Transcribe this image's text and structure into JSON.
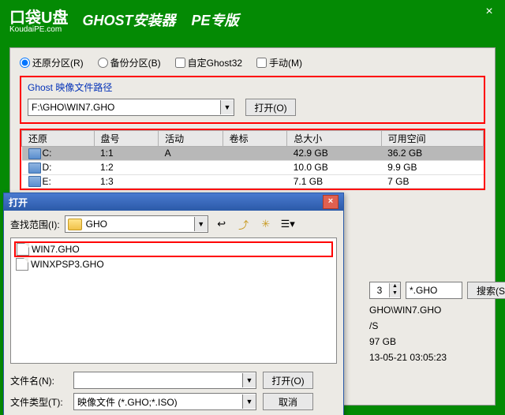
{
  "header": {
    "logo_main": "口袋U盘",
    "logo_sub": "KoudaiPE.com",
    "title_installer": "GHOST安装器",
    "title_edition": "PE专版",
    "close": "×"
  },
  "radios": {
    "restore": "还原分区(R)",
    "backup": "备份分区(B)",
    "custom": "自定Ghost32",
    "manual": "手动(M)"
  },
  "ghost_group": {
    "title": "Ghost 映像文件路径",
    "path": "F:\\GHO\\WIN7.GHO",
    "open_btn": "打开(O)"
  },
  "grid": {
    "headers": [
      "还原",
      "盘号",
      "活动",
      "卷标",
      "总大小",
      "可用空间"
    ],
    "rows": [
      {
        "drive": "C:",
        "num": "1:1",
        "active": "A",
        "label": "",
        "total": "42.9 GB",
        "free": "36.2 GB",
        "sel": true
      },
      {
        "drive": "D:",
        "num": "1:2",
        "active": "",
        "label": "",
        "total": "10.0 GB",
        "free": "9.9 GB",
        "sel": false
      },
      {
        "drive": "E:",
        "num": "1:3",
        "active": "",
        "label": "",
        "total": "7.1 GB",
        "free": "7 GB",
        "sel": false
      }
    ]
  },
  "opendlg": {
    "title": "打开",
    "lookin_label": "查找范围(I):",
    "folder": "GHO",
    "files": [
      {
        "name": "WIN7.GHO",
        "sel": true
      },
      {
        "name": "WINXPSP3.GHO",
        "sel": false
      }
    ],
    "filename_label": "文件名(N):",
    "filename_value": "",
    "filetype_label": "文件类型(T):",
    "filetype_value": "映像文件 (*.GHO;*.ISO)",
    "open_btn": "打开(O)",
    "cancel_btn": "取消"
  },
  "right": {
    "spin_value": "3",
    "ext_filter": "*.GHO",
    "search_btn": "搜索(S)",
    "line_path": "GHO\\WIN7.GHO",
    "line_fs": "/S",
    "line_size": "97 GB",
    "line_date": "13-05-21 03:05:23"
  }
}
